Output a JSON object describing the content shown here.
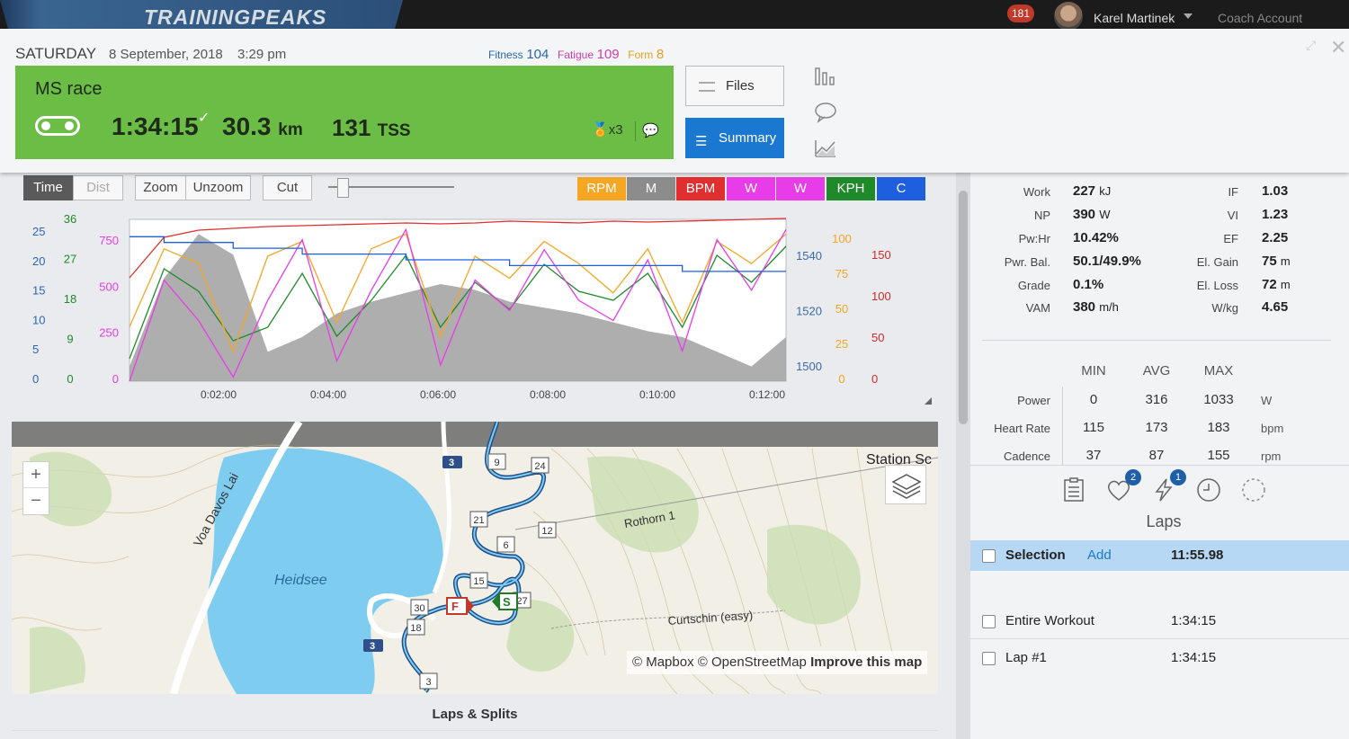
{
  "topbar": {
    "logo": "TRAININGPEAKS",
    "notifications": "181",
    "user": "Karel Martinek",
    "account": "Coach Account"
  },
  "workout": {
    "day": "SATURDAY",
    "date": "8 September, 2018",
    "time": "3:29 pm",
    "fitness_label": "Fitness",
    "fitness": "104",
    "fatigue_label": "Fatigue",
    "fatigue": "109",
    "form_label": "Form",
    "form": "8",
    "title": "MS race",
    "duration": "1:34:15",
    "distance": "30.3",
    "distance_unit": "km",
    "tss": "131",
    "tss_unit": "TSS",
    "medals": "x3",
    "files_label": "Files",
    "summary_label": "Summary"
  },
  "chart_toolbar": {
    "time": "Time",
    "dist": "Dist",
    "zoom": "Zoom",
    "unzoom": "Unzoom",
    "cut": "Cut",
    "channels": [
      {
        "label": "RPM",
        "color": "#f5a623"
      },
      {
        "label": "M",
        "color": "#8c8c8c"
      },
      {
        "label": "BPM",
        "color": "#e02f2f"
      },
      {
        "label": "W",
        "color": "#e83ce8"
      },
      {
        "label": "W",
        "color": "#e83ce8"
      },
      {
        "label": "KPH",
        "color": "#1f8a2a"
      },
      {
        "label": "C",
        "color": "#1e5fe0"
      }
    ]
  },
  "chart_data": {
    "type": "line",
    "x_ticks": [
      "0:02:00",
      "0:04:00",
      "0:06:00",
      "0:08:00",
      "0:10:00",
      "0:12:00"
    ],
    "axes": {
      "blue_left": [
        "25",
        "20",
        "15",
        "10",
        "5",
        "0"
      ],
      "green_left": [
        "36",
        "27",
        "18",
        "9",
        "0"
      ],
      "magenta_left": [
        "750",
        "500",
        "250",
        "0"
      ],
      "elevation": [
        "1540",
        "1520",
        "1500"
      ],
      "cadence": [
        "100",
        "75",
        "50",
        "25",
        "0"
      ],
      "heart_rate": [
        "150",
        "100",
        "50",
        "0"
      ]
    },
    "series": [
      {
        "name": "Elevation",
        "unit": "m",
        "color": "#8c8c8c",
        "values": [
          1500,
          1530,
          1545,
          1538,
          1505,
          1510,
          1518,
          1522,
          1525,
          1528,
          1526,
          1522,
          1520,
          1518,
          1515,
          1512,
          1510,
          1505,
          1500,
          1510
        ]
      },
      {
        "name": "Heart Rate",
        "unit": "bpm",
        "color": "#e02f2f",
        "values": [
          115,
          160,
          168,
          170,
          172,
          173,
          174,
          175,
          176,
          175,
          176,
          178,
          177,
          176,
          178,
          177,
          178,
          179,
          180,
          181
        ]
      },
      {
        "name": "Speed",
        "unit": "kph",
        "color": "#1f8a2a",
        "values": [
          5,
          25,
          20,
          9,
          12,
          24,
          10,
          18,
          28,
          12,
          22,
          16,
          26,
          20,
          18,
          24,
          12,
          28,
          22,
          30
        ]
      },
      {
        "name": "Cadence",
        "unit": "rpm",
        "color": "#f5a623",
        "values": [
          37,
          90,
          80,
          20,
          85,
          95,
          40,
          90,
          100,
          30,
          85,
          70,
          95,
          80,
          60,
          90,
          40,
          95,
          80,
          100
        ]
      },
      {
        "name": "Power",
        "unit": "W",
        "color": "#e83ce8",
        "values": [
          0,
          500,
          300,
          20,
          400,
          700,
          100,
          450,
          750,
          80,
          500,
          350,
          650,
          400,
          300,
          600,
          150,
          700,
          450,
          750
        ]
      },
      {
        "name": "Temperature",
        "unit": "C",
        "color": "#1e5fe0",
        "values": [
          25,
          24,
          24,
          23,
          23,
          22,
          22,
          22,
          21,
          21,
          21,
          20,
          20,
          20,
          20,
          20,
          19,
          19,
          19,
          19
        ]
      }
    ]
  },
  "map": {
    "lake": "Heidsee",
    "roads": [
      "Voa Davos Lai",
      "Rothorn 1",
      "Curtschin (easy)",
      "Station Sc"
    ],
    "markers": [
      "9",
      "24",
      "21",
      "12",
      "6",
      "15",
      "27",
      "30",
      "18",
      "3"
    ],
    "start": "S",
    "finish": "F",
    "credit_mapbox": "© Mapbox",
    "credit_osm": "© OpenStreetMap",
    "credit_improve": "Improve this map"
  },
  "laps_splits_label": "Laps & Splits",
  "stats_left": [
    {
      "label": "Work",
      "value": "227",
      "unit": "kJ"
    },
    {
      "label": "NP",
      "value": "390",
      "unit": "W"
    },
    {
      "label": "Pw:Hr",
      "value": "10.42%",
      "unit": ""
    },
    {
      "label": "Pwr. Bal.",
      "value": "50.1/49.9%",
      "unit": ""
    },
    {
      "label": "Grade",
      "value": "0.1%",
      "unit": ""
    },
    {
      "label": "VAM",
      "value": "380",
      "unit": "m/h"
    }
  ],
  "stats_right": [
    {
      "label": "IF",
      "value": "1.03",
      "unit": ""
    },
    {
      "label": "VI",
      "value": "1.23",
      "unit": ""
    },
    {
      "label": "EF",
      "value": "2.25",
      "unit": ""
    },
    {
      "label": "El. Gain",
      "value": "75",
      "unit": "m"
    },
    {
      "label": "El. Loss",
      "value": "72",
      "unit": "m"
    },
    {
      "label": "W/kg",
      "value": "4.65",
      "unit": ""
    }
  ],
  "minavgmax": {
    "headers": [
      "MIN",
      "AVG",
      "MAX"
    ],
    "rows": [
      {
        "label": "Power",
        "min": "0",
        "avg": "316",
        "max": "1033",
        "unit": "W"
      },
      {
        "label": "Heart Rate",
        "min": "115",
        "avg": "173",
        "max": "183",
        "unit": "bpm"
      },
      {
        "label": "Cadence",
        "min": "37",
        "avg": "87",
        "max": "155",
        "unit": "rpm"
      }
    ]
  },
  "tab_badges": {
    "heart": "2",
    "power": "1"
  },
  "laps": {
    "title": "Laps",
    "selection": {
      "name": "Selection",
      "add": "Add",
      "time": "11:55.98"
    },
    "rows": [
      {
        "name": "Entire Workout",
        "time": "1:34:15"
      },
      {
        "name": "Lap #1",
        "time": "1:34:15"
      }
    ]
  }
}
